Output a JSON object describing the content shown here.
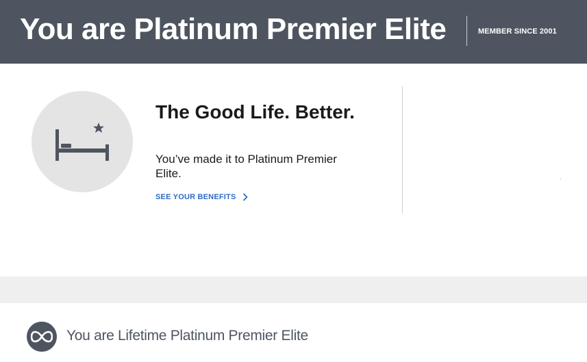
{
  "banner": {
    "title": "You are Platinum Premier Elite",
    "member_since": "MEMBER SINCE 2001",
    "background_color": "#4e5560"
  },
  "promo": {
    "icon": "bed-star-icon",
    "headline": "The Good Life. Better.",
    "subtext": "You’ve made it to Platinum Premier Elite.",
    "link_label": "SEE YOUR BENEFITS",
    "link_icon": "chevron-right-icon",
    "link_color": "#2d6bc4"
  },
  "lifetime": {
    "icon": "infinity-icon",
    "text": "You are Lifetime Platinum Premier Elite"
  }
}
